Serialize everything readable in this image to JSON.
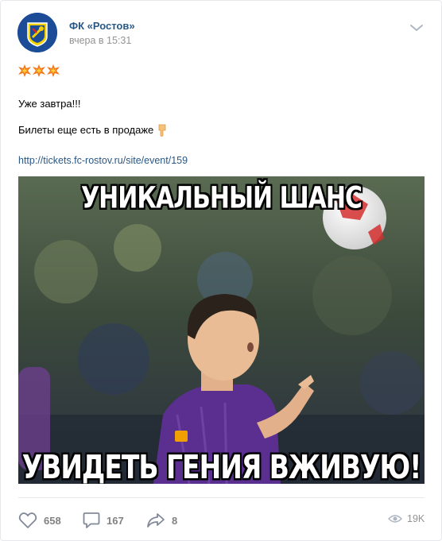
{
  "post": {
    "author": "ФК «Ростов»",
    "time": "вчера в 15:31",
    "emojis": [
      "collision-emoji",
      "collision-emoji",
      "collision-emoji"
    ],
    "text_line1": "Уже завтра!!!",
    "text_line2": "Билеты еще есть в продаже",
    "pointing_emoji": "pointing-down-emoji",
    "link": "http://tickets.fc-rostov.ru/site/event/159",
    "image": {
      "top_caption": "УНИКАЛЬНЫЙ ШАНС",
      "bottom_caption": "УВИДЕТЬ ГЕНИЯ ВЖИВУЮ!"
    }
  },
  "actions": {
    "likes": "658",
    "comments": "167",
    "shares": "8",
    "views": "19K"
  },
  "colors": {
    "link": "#2a5885",
    "muted": "#939393",
    "icon": "#828a99",
    "club_blue": "#1c4c98",
    "club_yellow": "#f5d000"
  }
}
